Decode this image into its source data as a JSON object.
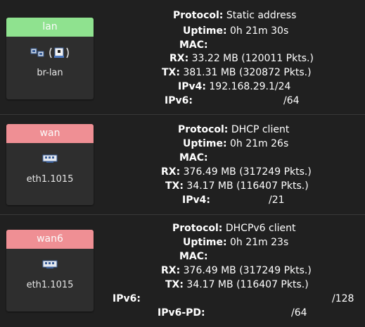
{
  "colors": {
    "lan_header": "#8fe28f",
    "wan_header": "#ef8f94",
    "wan6_header": "#ef8f94"
  },
  "interfaces": [
    {
      "name": "lan",
      "device": "br-lan",
      "icons": [
        "ethernet-switch-icon",
        "wireless-bridge-icon"
      ],
      "fields": [
        {
          "label": "Protocol:",
          "value": "Static address"
        },
        {
          "label": "Uptime:",
          "value": "0h 21m 30s"
        },
        {
          "label": "MAC:",
          "value": ""
        },
        {
          "label": "RX:",
          "value": "33.22 MB (120011 Pkts.)"
        },
        {
          "label": "TX:",
          "value": "381.31 MB (320872 Pkts.)"
        },
        {
          "label": "IPv4:",
          "value": "192.168.29.1/24"
        },
        {
          "label": "IPv6:",
          "value": "/64"
        }
      ]
    },
    {
      "name": "wan",
      "device": "eth1.1015",
      "icons": [
        "ethernet-port-icon"
      ],
      "fields": [
        {
          "label": "Protocol:",
          "value": "DHCP client"
        },
        {
          "label": "Uptime:",
          "value": "0h 21m 26s"
        },
        {
          "label": "MAC:",
          "value": ""
        },
        {
          "label": "RX:",
          "value": "376.49 MB (317249 Pkts.)"
        },
        {
          "label": "TX:",
          "value": "34.17 MB (116407 Pkts.)"
        },
        {
          "label": "IPv4:",
          "value": "/21"
        }
      ]
    },
    {
      "name": "wan6",
      "device": "eth1.1015",
      "icons": [
        "ethernet-port-icon"
      ],
      "fields": [
        {
          "label": "Protocol:",
          "value": "DHCPv6 client"
        },
        {
          "label": "Uptime:",
          "value": "0h 21m 23s"
        },
        {
          "label": "MAC:",
          "value": ""
        },
        {
          "label": "RX:",
          "value": "376.49 MB (317249 Pkts.)"
        },
        {
          "label": "TX:",
          "value": "34.17 MB (116407 Pkts.)"
        },
        {
          "label": "IPv6:",
          "value": "/128"
        },
        {
          "label": "IPv6-PD:",
          "value": "/64"
        }
      ]
    }
  ]
}
